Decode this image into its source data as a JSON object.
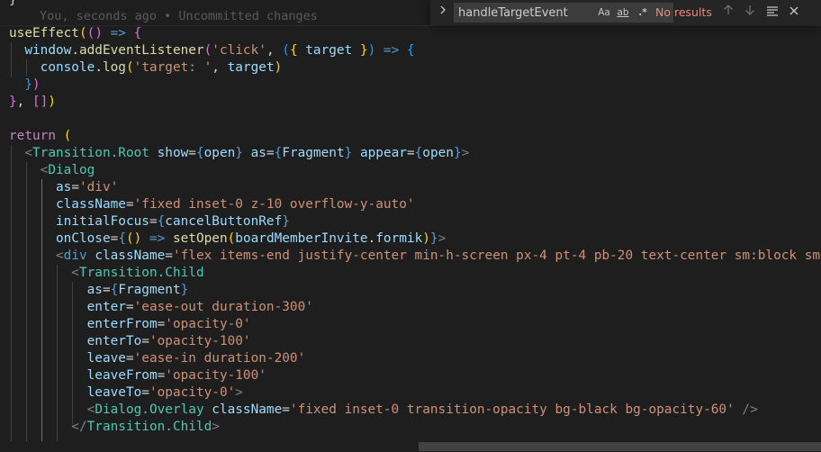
{
  "editor": {
    "blame": "You, seconds ago • Uncommitted changes",
    "top_fragment": "}",
    "lines": [
      {
        "tokens": [
          [
            "useEffect",
            "fn"
          ],
          [
            "(",
            "b1"
          ],
          [
            "()",
            "b2"
          ],
          [
            " => ",
            "kw"
          ],
          [
            "{",
            "b2"
          ]
        ]
      },
      {
        "tokens": [
          [
            "  window",
            "var"
          ],
          [
            ".",
            "p"
          ],
          [
            "addEventListener",
            "fn"
          ],
          [
            "(",
            "b2"
          ],
          [
            "'click'",
            "str"
          ],
          [
            ", ",
            "p"
          ],
          [
            "(",
            "b3"
          ],
          [
            "{",
            "b1"
          ],
          [
            " target ",
            "var"
          ],
          [
            "}",
            "b1"
          ],
          [
            ")",
            "b3"
          ],
          [
            " => ",
            "kw"
          ],
          [
            "{",
            "b3"
          ]
        ]
      },
      {
        "tokens": [
          [
            "    console",
            "var"
          ],
          [
            ".",
            "p"
          ],
          [
            "log",
            "fn"
          ],
          [
            "(",
            "b1"
          ],
          [
            "'target: '",
            "str"
          ],
          [
            ", ",
            "p"
          ],
          [
            "target",
            "var"
          ],
          [
            ")",
            "b1"
          ]
        ]
      },
      {
        "tokens": [
          [
            "  }",
            "b3"
          ],
          [
            ")",
            "b2"
          ]
        ]
      },
      {
        "tokens": [
          [
            "}",
            "b2"
          ],
          [
            ", ",
            "p"
          ],
          [
            "[]",
            "b2"
          ],
          [
            ")",
            "b1"
          ]
        ]
      },
      {
        "tokens": []
      },
      {
        "tokens": [
          [
            "return",
            "ctl"
          ],
          [
            " (",
            "b1"
          ]
        ]
      },
      {
        "tokens": [
          [
            "  <",
            "tagp"
          ],
          [
            "Transition.Root",
            "tag"
          ],
          [
            " show",
            "attr"
          ],
          [
            "=",
            "p"
          ],
          [
            "{",
            "kw"
          ],
          [
            "open",
            "var"
          ],
          [
            "}",
            "kw"
          ],
          [
            " as",
            "attr"
          ],
          [
            "=",
            "p"
          ],
          [
            "{",
            "kw"
          ],
          [
            "Fragment",
            "var"
          ],
          [
            "}",
            "kw"
          ],
          [
            " appear",
            "attr"
          ],
          [
            "=",
            "p"
          ],
          [
            "{",
            "kw"
          ],
          [
            "open",
            "var"
          ],
          [
            "}",
            "kw"
          ],
          [
            ">",
            "tagp"
          ]
        ]
      },
      {
        "tokens": [
          [
            "    <",
            "tagp"
          ],
          [
            "Dialog",
            "tag"
          ]
        ]
      },
      {
        "tokens": [
          [
            "      as",
            "attr"
          ],
          [
            "=",
            "p"
          ],
          [
            "'div'",
            "str"
          ]
        ]
      },
      {
        "tokens": [
          [
            "      className",
            "attr"
          ],
          [
            "=",
            "p"
          ],
          [
            "'fixed inset-0 z-10 overflow-y-auto'",
            "str"
          ]
        ]
      },
      {
        "tokens": [
          [
            "      initialFocus",
            "attr"
          ],
          [
            "=",
            "p"
          ],
          [
            "{",
            "kw"
          ],
          [
            "cancelButtonRef",
            "var"
          ],
          [
            "}",
            "kw"
          ]
        ]
      },
      {
        "tokens": [
          [
            "      onClose",
            "attr"
          ],
          [
            "=",
            "p"
          ],
          [
            "{",
            "kw"
          ],
          [
            "()",
            "b1"
          ],
          [
            " => ",
            "kw"
          ],
          [
            "setOpen",
            "fn"
          ],
          [
            "(",
            "b1"
          ],
          [
            "boardMemberInvite",
            "var"
          ],
          [
            ".",
            "p"
          ],
          [
            "formik",
            "var"
          ],
          [
            ")",
            "b1"
          ],
          [
            "}",
            "kw"
          ],
          [
            ">",
            "tagp"
          ]
        ]
      },
      {
        "tokens": [
          [
            "      <",
            "tagp"
          ],
          [
            "div",
            "kw"
          ],
          [
            " className",
            "attr"
          ],
          [
            "=",
            "p"
          ],
          [
            "'flex items-end justify-center min-h-screen px-4 pt-4 pb-20 text-center sm:block sm:p-",
            "str"
          ]
        ]
      },
      {
        "tokens": [
          [
            "        <",
            "tagp"
          ],
          [
            "Transition.Child",
            "tag"
          ]
        ]
      },
      {
        "tokens": [
          [
            "          as",
            "attr"
          ],
          [
            "=",
            "p"
          ],
          [
            "{",
            "kw"
          ],
          [
            "Fragment",
            "var"
          ],
          [
            "}",
            "kw"
          ]
        ]
      },
      {
        "tokens": [
          [
            "          enter",
            "attr"
          ],
          [
            "=",
            "p"
          ],
          [
            "'ease-out duration-300'",
            "str"
          ]
        ]
      },
      {
        "tokens": [
          [
            "          enterFrom",
            "attr"
          ],
          [
            "=",
            "p"
          ],
          [
            "'opacity-0'",
            "str"
          ]
        ]
      },
      {
        "tokens": [
          [
            "          enterTo",
            "attr"
          ],
          [
            "=",
            "p"
          ],
          [
            "'opacity-100'",
            "str"
          ]
        ]
      },
      {
        "tokens": [
          [
            "          leave",
            "attr"
          ],
          [
            "=",
            "p"
          ],
          [
            "'ease-in duration-200'",
            "str"
          ]
        ]
      },
      {
        "tokens": [
          [
            "          leaveFrom",
            "attr"
          ],
          [
            "=",
            "p"
          ],
          [
            "'opacity-100'",
            "str"
          ]
        ]
      },
      {
        "tokens": [
          [
            "          leaveTo",
            "attr"
          ],
          [
            "=",
            "p"
          ],
          [
            "'opacity-0'",
            "str"
          ],
          [
            ">",
            "tagp"
          ]
        ]
      },
      {
        "tokens": [
          [
            "          <",
            "tagp"
          ],
          [
            "Dialog.Overlay",
            "tag"
          ],
          [
            " className",
            "attr"
          ],
          [
            "=",
            "p"
          ],
          [
            "'fixed inset-0 transition-opacity bg-black bg-opacity-60'",
            "str"
          ],
          [
            " />",
            "tagp"
          ]
        ]
      },
      {
        "tokens": [
          [
            "        </",
            "tagp"
          ],
          [
            "Transition.Child",
            "tag"
          ],
          [
            ">",
            "tagp"
          ]
        ]
      }
    ]
  },
  "find_widget": {
    "query": "handleTargetEvent",
    "match_case_label": "Aa",
    "whole_word_label": "ab",
    "regex_label": ".*",
    "status": "No results",
    "toggle_icon": "chevron-right-icon",
    "prev_icon": "arrow-up-icon",
    "next_icon": "arrow-down-icon",
    "selection_icon": "find-in-selection-icon",
    "close_icon": "close-icon"
  },
  "colors": {
    "background": "#1e1e1e",
    "keyword": "#569cd6",
    "control": "#c586c0",
    "function": "#dcdcaa",
    "variable": "#9cdcfe",
    "string": "#ce9178",
    "component": "#4ec9b0",
    "tag_punct": "#808080",
    "no_results": "#f48771"
  }
}
